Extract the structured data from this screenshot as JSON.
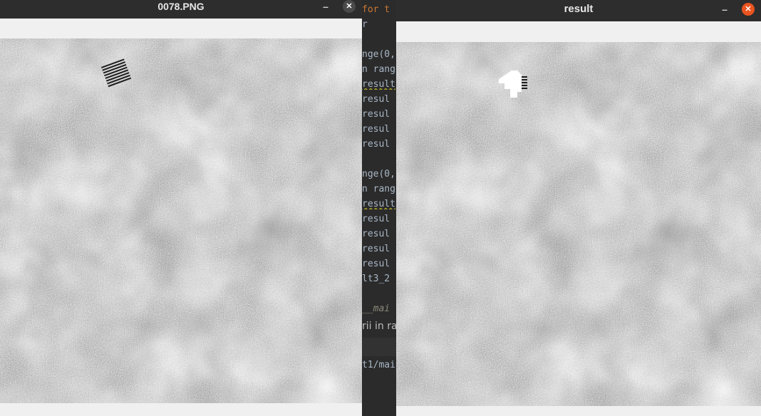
{
  "editor": {
    "lines": [
      {
        "text": "for t",
        "cls": "kw"
      },
      {
        "text": "    r",
        "cls": ""
      },
      {
        "text": "nge(0,",
        "cls": ""
      },
      {
        "text": "n range",
        "cls": ""
      },
      {
        "text": "result",
        "cls": "squiggle"
      },
      {
        "text": " resul",
        "cls": ""
      },
      {
        "text": " resul",
        "cls": ""
      },
      {
        "text": " resul",
        "cls": ""
      },
      {
        "text": " resul",
        "cls": ""
      },
      {
        "text": "nge(0,",
        "cls": ""
      },
      {
        "text": "n range",
        "cls": ""
      },
      {
        "text": "result",
        "cls": "squiggle"
      },
      {
        "text": " resul",
        "cls": ""
      },
      {
        "text": " resul",
        "cls": ""
      },
      {
        "text": " resul",
        "cls": ""
      },
      {
        "text": " resul",
        "cls": ""
      },
      {
        "text": "lt3_2",
        "cls": ""
      },
      {
        "text": "__mai",
        "cls": "mainline"
      },
      {
        "text": "t1/mai",
        "cls": ""
      }
    ],
    "hint": "rii in ra"
  },
  "left_window": {
    "title": "0078.PNG",
    "minimize_glyph": "–",
    "close_glyph": "✕"
  },
  "right_window": {
    "title": "result",
    "minimize_glyph": "–",
    "close_glyph": "✕"
  },
  "colors": {
    "titlebar": "#2d2d2d",
    "close_active": "#e95420",
    "close_inactive": "#4a4a4a",
    "window_bg": "#f0f0f0"
  }
}
